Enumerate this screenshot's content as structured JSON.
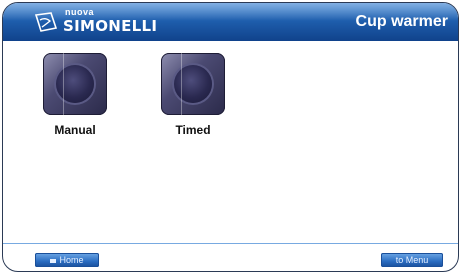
{
  "header": {
    "brand_small": "nuova",
    "brand_big": "SIMONELLI",
    "title": "Cup warmer"
  },
  "options": [
    {
      "label": "Manual"
    },
    {
      "label": "Timed"
    }
  ],
  "footer": {
    "home_label": "Home",
    "menu_label": "to Menu"
  },
  "colors": {
    "header_blue": "#1f5fae",
    "tile_purple": "#4b4a72"
  }
}
